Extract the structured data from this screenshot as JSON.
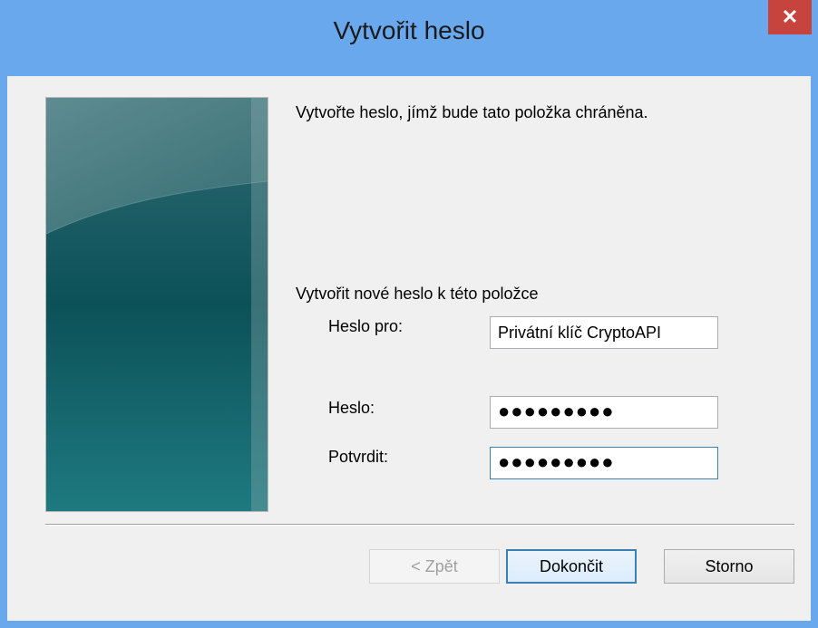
{
  "window": {
    "title": "Vytvořit heslo"
  },
  "content": {
    "intro": "Vytvořte heslo, jímž bude tato položka chráněna.",
    "group_label": "Vytvořit nové heslo k této položce",
    "fields": {
      "for_label": "Heslo pro:",
      "for_value": "Privátní klíč CryptoAPI",
      "password_label": "Heslo:",
      "password_value": "●●●●●●●●●",
      "confirm_label": "Potvrdit:",
      "confirm_value": "●●●●●●●●●"
    }
  },
  "buttons": {
    "back": "< Zpět",
    "finish": "Dokončit",
    "cancel": "Storno"
  },
  "icons": {
    "close": "close-icon",
    "side_image": "wizard-side-image"
  },
  "colors": {
    "titlebar": "#6aa8ee",
    "close": "#c7443e",
    "panel": "#f0f0f0",
    "focus_border": "#3c7fb1"
  }
}
